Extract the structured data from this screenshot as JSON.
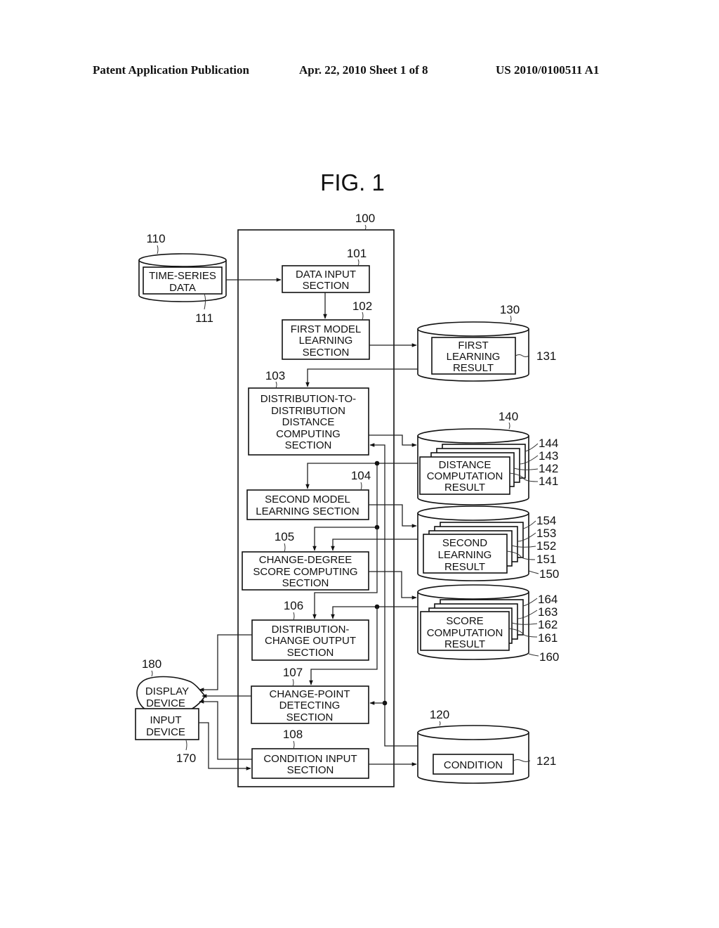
{
  "header": {
    "left": "Patent Application Publication",
    "center": "Apr. 22, 2010  Sheet 1 of 8",
    "right": "US 2010/0100511 A1"
  },
  "figure": {
    "title": "FIG. 1",
    "system": {
      "ref": "100"
    },
    "sections": [
      {
        "ref": "101",
        "lines": [
          "DATA INPUT",
          "SECTION"
        ]
      },
      {
        "ref": "102",
        "lines": [
          "FIRST MODEL",
          "LEARNING",
          "SECTION"
        ]
      },
      {
        "ref": "103",
        "lines": [
          "DISTRIBUTION-TO-",
          "DISTRIBUTION",
          "DISTANCE",
          "COMPUTING",
          "SECTION"
        ]
      },
      {
        "ref": "104",
        "lines": [
          "SECOND MODEL",
          "LEARNING SECTION"
        ]
      },
      {
        "ref": "105",
        "lines": [
          "CHANGE-DEGREE",
          "SCORE COMPUTING",
          "SECTION"
        ]
      },
      {
        "ref": "106",
        "lines": [
          "DISTRIBUTION-",
          "CHANGE OUTPUT",
          "SECTION"
        ]
      },
      {
        "ref": "107",
        "lines": [
          "CHANGE-POINT",
          "DETECTING",
          "SECTION"
        ]
      },
      {
        "ref": "108",
        "lines": [
          "CONDITION INPUT",
          "SECTION"
        ]
      }
    ],
    "storages": {
      "time_series": {
        "ref": "110",
        "inner_ref": "111",
        "lines": [
          "TIME-SERIES",
          "DATA"
        ]
      },
      "first_learning": {
        "ref": "130",
        "inner_ref": "131",
        "lines": [
          "FIRST",
          "LEARNING",
          "RESULT"
        ]
      },
      "distance": {
        "ref": "140",
        "stack_refs": [
          "144",
          "143",
          "142",
          "141"
        ],
        "lines": [
          "DISTANCE",
          "COMPUTATION",
          "RESULT"
        ]
      },
      "second_learning": {
        "ref": "150",
        "stack_refs": [
          "154",
          "153",
          "152",
          "151"
        ],
        "lines": [
          "SECOND",
          "LEARNING",
          "RESULT"
        ]
      },
      "score": {
        "ref": "160",
        "stack_refs": [
          "164",
          "163",
          "162",
          "161"
        ],
        "lines": [
          "SCORE",
          "COMPUTATION",
          "RESULT"
        ]
      },
      "condition": {
        "ref": "120",
        "inner_ref": "121",
        "lines": [
          "CONDITION"
        ]
      }
    },
    "devices": {
      "display": {
        "ref": "180",
        "lines": [
          "DISPLAY",
          "DEVICE"
        ]
      },
      "input": {
        "ref": "170",
        "lines": [
          "INPUT",
          "DEVICE"
        ]
      }
    }
  }
}
